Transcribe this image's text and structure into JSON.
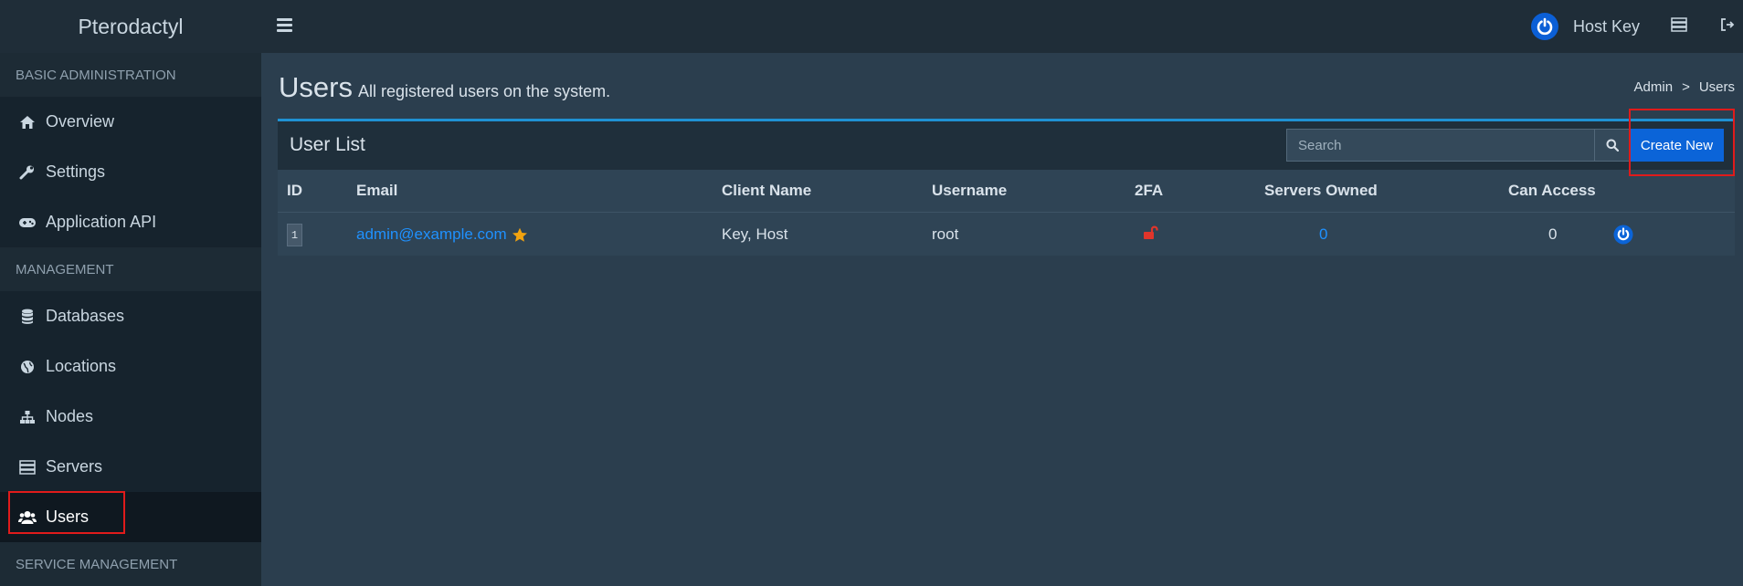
{
  "app": {
    "brand": "Pterodactyl"
  },
  "header": {
    "user_name": "Host Key"
  },
  "sidebar": {
    "sections": [
      {
        "label": "BASIC ADMINISTRATION",
        "items": [
          {
            "label": "Overview",
            "icon": "home-icon"
          },
          {
            "label": "Settings",
            "icon": "wrench-icon"
          },
          {
            "label": "Application API",
            "icon": "gamepad-icon"
          }
        ]
      },
      {
        "label": "MANAGEMENT",
        "items": [
          {
            "label": "Databases",
            "icon": "database-icon"
          },
          {
            "label": "Locations",
            "icon": "globe-icon"
          },
          {
            "label": "Nodes",
            "icon": "sitemap-icon"
          },
          {
            "label": "Servers",
            "icon": "server-icon"
          },
          {
            "label": "Users",
            "icon": "users-icon",
            "active": true
          }
        ]
      },
      {
        "label": "SERVICE MANAGEMENT",
        "items": []
      }
    ]
  },
  "page": {
    "title": "Users",
    "subtitle": "All registered users on the system.",
    "breadcrumb": {
      "root": "Admin",
      "sep": ">",
      "current": "Users"
    }
  },
  "box": {
    "title": "User List",
    "search_placeholder": "Search",
    "create_label": "Create New"
  },
  "table": {
    "headers": [
      "ID",
      "Email",
      "Client Name",
      "Username",
      "2FA",
      "Servers Owned",
      "Can Access"
    ],
    "rows": [
      {
        "id": "1",
        "email": "admin@example.com",
        "client_name": "Key, Host",
        "username": "root",
        "servers_owned": "0",
        "can_access": "0"
      }
    ]
  },
  "colors": {
    "accent": "#1f91d3",
    "primary_button": "#0b64d8",
    "link": "#1f91ff",
    "danger": "#e0352b",
    "star": "#f2a30f"
  }
}
